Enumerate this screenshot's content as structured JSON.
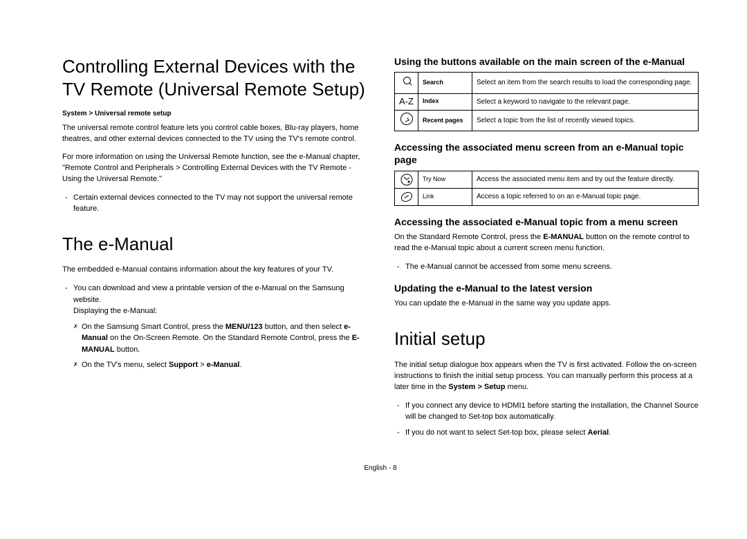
{
  "left": {
    "h1a": "Controlling External Devices with the TV Remote (Universal Remote Setup)",
    "path": "System > Universal remote setup",
    "p1": "The universal remote control feature lets you control cable boxes, Blu-ray players, home theatres, and other external devices connected to the TV using the TV's remote control.",
    "p2": "For more information on using the Universal Remote function, see the e-Manual chapter, \"Remote Control and Peripherals > Controlling External Devices with the TV Remote - Using the Universal Remote.\"",
    "li1": "Certain external devices connected to the TV may not support the universal remote feature.",
    "h1b": "The e-Manual",
    "p3": "The embedded e-Manual contains information about the key features of your TV.",
    "li2a": "You can download and view a printable version of the e-Manual on the Samsung website.",
    "li2b": "Displaying the e-Manual:",
    "inner1_pre": "On the Samsung Smart Control, press the ",
    "inner1_b1": "MENU/123",
    "inner1_mid": " button, and then select ",
    "inner1_b2": "e-Manual",
    "inner1_mid2": " on the On-Screen Remote. On the Standard Remote Control, press the ",
    "inner1_b3": "E-MANUAL",
    "inner1_post": " button.",
    "inner2_pre": "On the TV's menu, select ",
    "inner2_b1": "Support",
    "inner2_mid": " > ",
    "inner2_b2": "e-Manual",
    "inner2_post": "."
  },
  "right": {
    "sub1": "Using the buttons available on the main screen of the e-Manual",
    "t1": [
      {
        "label": "Search",
        "desc": "Select an item from the search results to load the corresponding page."
      },
      {
        "label": "Index",
        "desc": "Select a keyword to navigate to the relevant page."
      },
      {
        "label": "Recent pages",
        "desc": "Select a topic from the list of recently viewed topics."
      }
    ],
    "sub2": "Accessing the associated menu screen from an e-Manual topic page",
    "t2": [
      {
        "label": "Try Now",
        "desc": "Access the associated menu item and try out the feature directly."
      },
      {
        "label": "Link",
        "desc": "Access a topic referred to on an e-Manual topic page."
      }
    ],
    "sub3": "Accessing the associated e-Manual topic from a menu screen",
    "p4_pre": "On the Standard Remote Control, press the ",
    "p4_b": "E-MANUAL",
    "p4_post": " button on the remote control to read the e-Manual topic about a current screen menu function.",
    "li3": "The e-Manual cannot be accessed from some menu screens.",
    "sub4": "Updating the e-Manual to the latest version",
    "p5": "You can update the e-Manual in the same way you update apps.",
    "h1c": "Initial setup",
    "p6_pre": "The initial setup dialogue box appears when the TV is first activated. Follow the on-screen instructions to finish the initial setup process. You can manually perform this process at a later time in the ",
    "p6_b": "System > Setup",
    "p6_post": " menu.",
    "li4": "If you connect any device to HDMI1 before starting the installation, the Channel Source will be changed to Set-top box automatically.",
    "li5_pre": "If you do not want to select Set-top box, please select ",
    "li5_b": "Aerial",
    "li5_post": "."
  },
  "footer": "English - 8"
}
